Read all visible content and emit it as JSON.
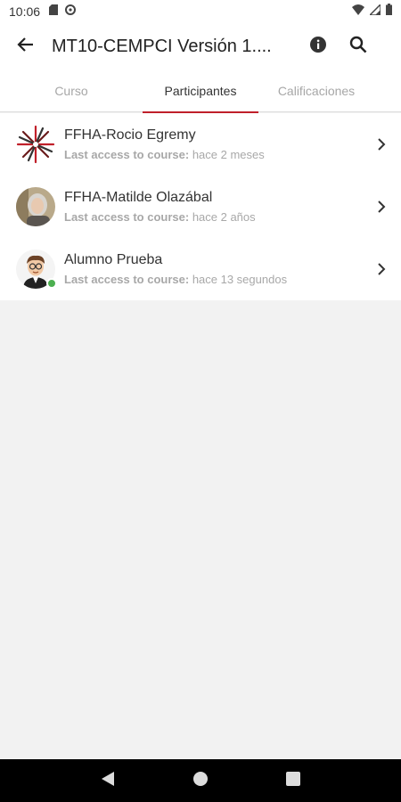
{
  "status_bar": {
    "time": "10:06",
    "left_icons": [
      "sd-card-icon",
      "sync-icon"
    ],
    "right_icons": [
      "wifi-icon",
      "signal-icon",
      "battery-icon"
    ]
  },
  "app_bar": {
    "title": "MT10-CEMPCI Versión 1....",
    "back_icon": "arrow-back-icon",
    "info_icon": "info-icon",
    "search_icon": "search-icon"
  },
  "tabs": [
    {
      "label": "Curso",
      "active": false
    },
    {
      "label": "Participantes",
      "active": true
    },
    {
      "label": "Calificaciones",
      "active": false
    }
  ],
  "accent_color": "#c0202a",
  "participants": [
    {
      "name": "FFHA-Rocio Egremy",
      "access_label": "Last access to course:",
      "access_value": "hace 2 meses",
      "online": false,
      "avatar": "starburst-logo"
    },
    {
      "name": "FFHA-Matilde Olazábal",
      "access_label": "Last access to course:",
      "access_value": "hace 2 años",
      "online": false,
      "avatar": "photo-woman"
    },
    {
      "name": "Alumno Prueba",
      "access_label": "Last access to course:",
      "access_value": "hace 13 segundos",
      "online": true,
      "avatar": "cartoon-man"
    }
  ],
  "nav_bar": {
    "icons": [
      "back-triangle-icon",
      "home-circle-icon",
      "recents-square-icon"
    ]
  }
}
